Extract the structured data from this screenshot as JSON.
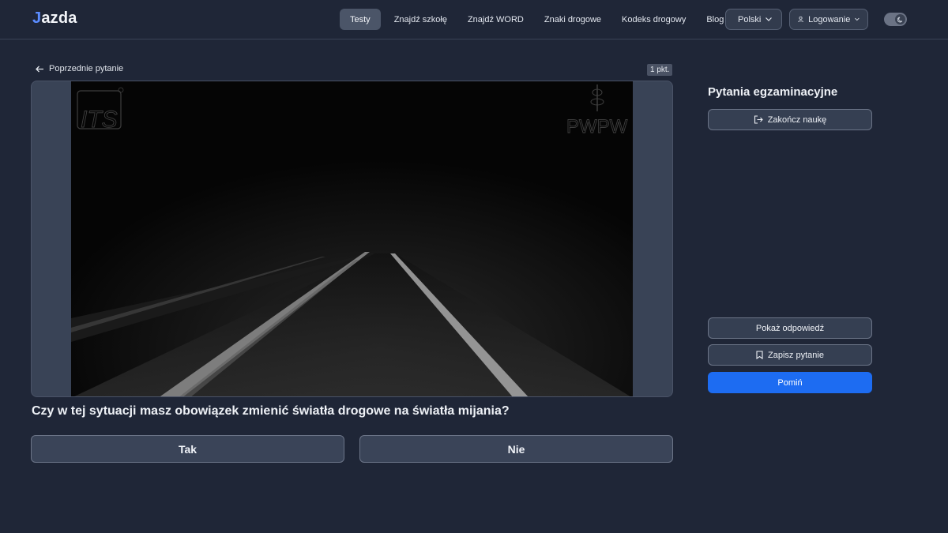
{
  "brand": {
    "logo_j": "J",
    "logo_rest": "azda"
  },
  "nav": {
    "links": [
      "Testy",
      "Znajdź szkołę",
      "Znajdź WORD",
      "Znaki drogowe",
      "Kodeks drogowy",
      "Blog"
    ],
    "active": "Testy",
    "language_label": "Polski",
    "login_label": "Logowanie"
  },
  "question": {
    "prev_label": "Poprzednie pytanie",
    "points_badge": "1 pkt.",
    "text": "Czy w tej sytuacji masz obowiązek zmienić światła drogowe na światła mijania?",
    "media_watermarks": {
      "left": "ITS",
      "right": "PWPW"
    },
    "answers": {
      "yes": "Tak",
      "no": "Nie"
    }
  },
  "sidebar": {
    "title": "Pytania egzaminacyjne",
    "finish_label": "Zakończ naukę",
    "show_answer_label": "Pokaż odpowiedź",
    "save_question_label": "Zapisz pytanie",
    "skip_label": "Pomiń"
  },
  "colors": {
    "background": "#1f2637",
    "primary": "#1d6cf2",
    "accent_logo": "#5b8cff"
  }
}
